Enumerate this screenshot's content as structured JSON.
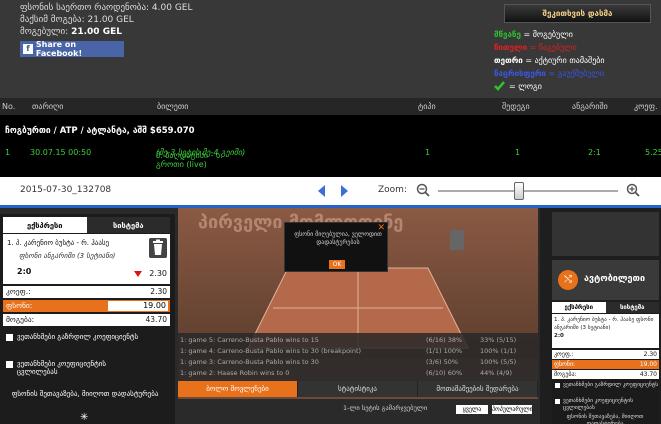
{
  "top": {
    "line1": "ფსონის საერთო რაოდენობა: 4.00 GEL",
    "line2": "მაქსიმ მოგება: 21.00 GEL",
    "line3_prefix": "მოგებული:",
    "line3_value": "21.00 GEL",
    "facebook_label": "Share on Facebook!",
    "check_button": "შეკითხვის დასმა",
    "legend": [
      {
        "term": "მწვანე",
        "desc": "= მოგებული",
        "color": "#2ec22e"
      },
      {
        "term": "წითელი",
        "desc": "= წაგებული",
        "color": "#e02020"
      },
      {
        "term": "თეთრი",
        "desc": "= აქტიური თამაშები",
        "color": "#ffffff"
      },
      {
        "term": "ნაცრისფერი",
        "desc": "= გაუქმებული",
        "color": "#3a57e8"
      }
    ],
    "legend_last": "= ლოგი"
  },
  "table": {
    "headers": [
      "No.",
      "თარიღი",
      "ბილეთი",
      "ტიპი",
      "შედეგი",
      "ანგარიში",
      "კოეფ."
    ],
    "group_title": "ჩოგბურთი / ATP / ატლანტა, აშშ $659.070",
    "row": {
      "no": "1",
      "date": "30.07.15 00:50",
      "ticket": "მ. ბაღდატისი - ს. გროთი (live)",
      "ticket_note": "(მე-3 სეტის მე-4 გეიმი)",
      "type": "1",
      "result": "1",
      "score": "2:1",
      "coef": "5.25"
    }
  },
  "toolbar": {
    "timeline_id": "2015-07-30_132708",
    "zoom_label": "Zoom:",
    "zoom_level": 0.45
  },
  "slip": {
    "tab_active": "ექსპრესი",
    "tab_other": "სისტემა",
    "event_line1": "1. პ. კარენიო ბუსტა - რ. ჰაასე",
    "event_line2": "ფსონი ანგარიში (3 სეტიანი)",
    "score": "2:0",
    "odd": "2.30",
    "coef_label": "კოეფ.:",
    "coef_value": "2.30",
    "stake_label": "ფსონი:",
    "stake_value": "19.00",
    "win_label": "მოგება:",
    "win_value": "43.70",
    "check1": "ვეთანხმები გაზრდილ კოეფიციენტს",
    "check2": "ვეთანხმები კოეფიციენტის ცვლილებას",
    "note": "ფსონის შეთავაზება, მიიღოთ დადასტურება"
  },
  "stage": {
    "court_title": "პირველი მომლოდინე",
    "dialog_msg": "ფსონი მიღებულია, ველოდით დადასტურებას",
    "dialog_ok": "OK",
    "plays": [
      {
        "text": "1: game 5: Carreno-Busta Pablo wins to 15",
        "stat": "(6/16) 38%",
        "pct": "33% (5/15)"
      },
      {
        "text": "1: game 4: Carreno-Busta Pablo wins to 30 (breakpoint)",
        "stat": "(1/1) 100%",
        "pct": "100% (1/1)"
      },
      {
        "text": "1: game 3: Carreno-Busta Pablo wins to 30",
        "stat": "(3/6) 50%",
        "pct": "100% (5/5)"
      },
      {
        "text": "1: game 2: Haase Robin wins to 0",
        "stat": "(6/10) 60%",
        "pct": "44% (4/9)"
      }
    ],
    "tabs": [
      "ბოლო მოვლენები",
      "სტატისტიკა",
      "მოთამაშეების შედარება"
    ],
    "btm_left": "1-ლი სეტის გამარჯვებული",
    "btm_b1": "ყველა",
    "btm_b2": "პოპულარული"
  },
  "rcol": {
    "logo_text": "ავტობილეთი",
    "tab1": "ექსპრესი",
    "tab2": "სისტემა",
    "ev": "1. პ. კარენიო ბუსტა - რ. ჰაასე ფსონი ანგარიში (3 სეტიანი)",
    "score": "2:0",
    "rows": [
      {
        "l": "კოეფ.:",
        "v": "2.30"
      },
      {
        "l": "ფსონი:",
        "v": "19.00"
      },
      {
        "l": "მოგება:",
        "v": "43.70"
      }
    ],
    "chk1": "ვეთანხმები გაზრდილ კოეფიციენტს",
    "chk2": "ვეთანხმები კოეფიციენტის ცვლილებას",
    "note": "ფსონის შეთავაზება, მიიღოთ დადასტურება"
  }
}
